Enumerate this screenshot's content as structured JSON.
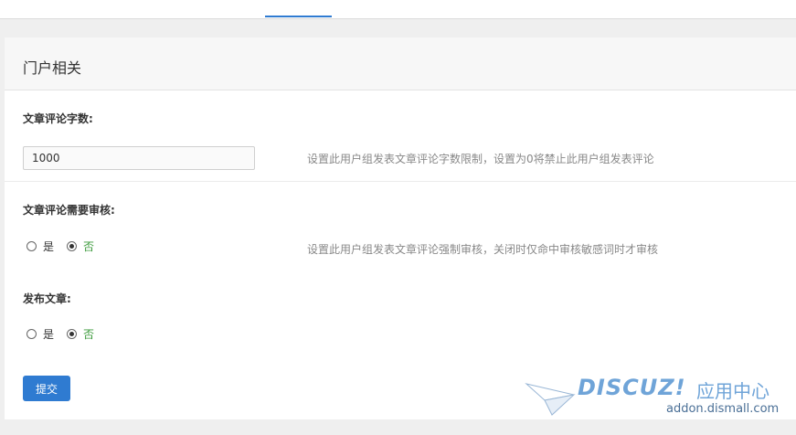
{
  "section": {
    "title": "门户相关"
  },
  "fields": {
    "comment_length": {
      "label": "文章评论字数:",
      "value": "1000",
      "help": "设置此用户组发表文章评论字数限制，设置为0将禁止此用户组发表评论"
    },
    "comment_moderation": {
      "label": "文章评论需要审核:",
      "options": [
        "是",
        "否"
      ],
      "selected": "否",
      "help": "设置此用户组发表文章评论强制审核，关闭时仅命中审核敏感词时才审核"
    },
    "publish_article": {
      "label": "发布文章:",
      "options": [
        "是",
        "否"
      ],
      "selected": "否"
    }
  },
  "actions": {
    "submit_label": "提交"
  },
  "watermark": {
    "logo": "DISCUZ!",
    "name": "应用中心",
    "domain": "addon.dismall.com"
  },
  "colors": {
    "accent": "#2f7bd1",
    "selected_option": "#3a9a3a"
  }
}
